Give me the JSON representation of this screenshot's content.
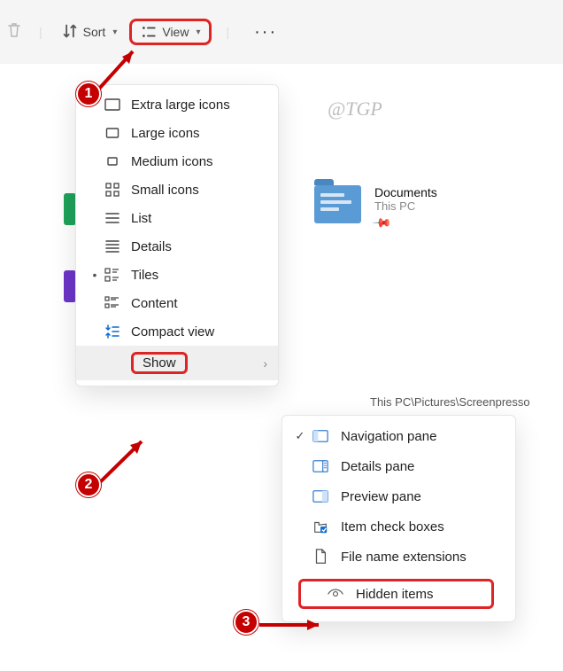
{
  "toolbar": {
    "sort_label": "Sort",
    "view_label": "View"
  },
  "watermark": "@TGP",
  "documents": {
    "title": "Documents",
    "subtitle": "This PC"
  },
  "path_text": "This PC\\Pictures\\Screenpresso",
  "view_menu": {
    "items": [
      {
        "label": "Extra large icons"
      },
      {
        "label": "Large icons"
      },
      {
        "label": "Medium icons"
      },
      {
        "label": "Small icons"
      },
      {
        "label": "List"
      },
      {
        "label": "Details"
      },
      {
        "label": "Tiles"
      },
      {
        "label": "Content"
      },
      {
        "label": "Compact view"
      },
      {
        "label": "Show"
      }
    ]
  },
  "show_menu": {
    "items": [
      {
        "label": "Navigation pane"
      },
      {
        "label": "Details pane"
      },
      {
        "label": "Preview pane"
      },
      {
        "label": "Item check boxes"
      },
      {
        "label": "File name extensions"
      },
      {
        "label": "Hidden items"
      }
    ]
  },
  "annotations": {
    "b1": "1",
    "b2": "2",
    "b3": "3"
  }
}
